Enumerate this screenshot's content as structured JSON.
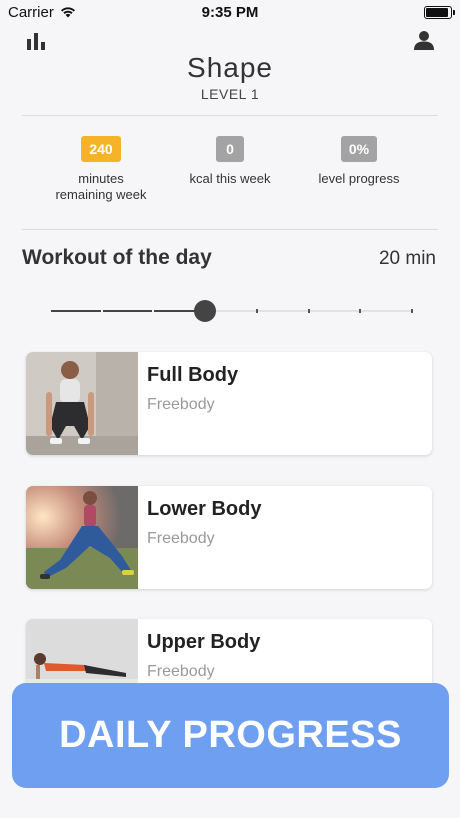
{
  "status_bar": {
    "carrier": "Carrier",
    "time": "9:35 PM"
  },
  "header": {
    "title": "Shape",
    "level": "LEVEL 1"
  },
  "stats": [
    {
      "value": "240",
      "label_line1": "minutes",
      "label_line2": "remaining week",
      "color": "#f5b428"
    },
    {
      "value": "0",
      "label_line1": "kcal this week",
      "label_line2": "",
      "color": "#a3a3a3"
    },
    {
      "value": "0%",
      "label_line1": "level progress",
      "label_line2": "",
      "color": "#a3a3a3"
    }
  ],
  "workout_of_day": {
    "title": "Workout of the day",
    "duration": "20 min",
    "slider_steps": 8,
    "slider_selected_step": 3
  },
  "workouts": [
    {
      "title": "Full Body",
      "subtitle": "Freebody",
      "image": "woman-squat-photo"
    },
    {
      "title": "Lower Body",
      "subtitle": "Freebody",
      "image": "woman-lunge-photo"
    },
    {
      "title": "Upper Body",
      "subtitle": "Freebody",
      "image": "woman-plank-photo"
    }
  ],
  "cta": {
    "label": "DAILY PROGRESS",
    "color": "#6e9ff0"
  }
}
